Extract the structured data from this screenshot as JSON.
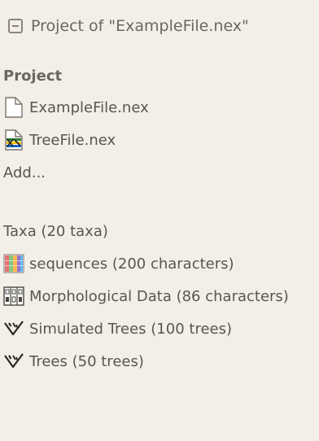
{
  "header": {
    "title": "Project of \"ExampleFile.nex\""
  },
  "project": {
    "heading": "Project",
    "files": [
      {
        "label": "ExampleFile.nex",
        "icon": "document-icon"
      },
      {
        "label": "TreeFile.nex",
        "icon": "tree-file-icon"
      }
    ],
    "add_label": "Add..."
  },
  "contents": {
    "taxa_label": "Taxa (20 taxa)",
    "items": [
      {
        "label": "sequences (200 characters)",
        "icon": "sequence-matrix-icon"
      },
      {
        "label": "Morphological Data (86 characters)",
        "icon": "categorical-matrix-icon"
      },
      {
        "label": "Simulated Trees (100 trees)",
        "icon": "tree-icon"
      },
      {
        "label": "Trees (50 trees)",
        "icon": "tree-icon"
      }
    ]
  },
  "colors": {
    "background": "#f3efe8",
    "text": "#5a554e"
  }
}
